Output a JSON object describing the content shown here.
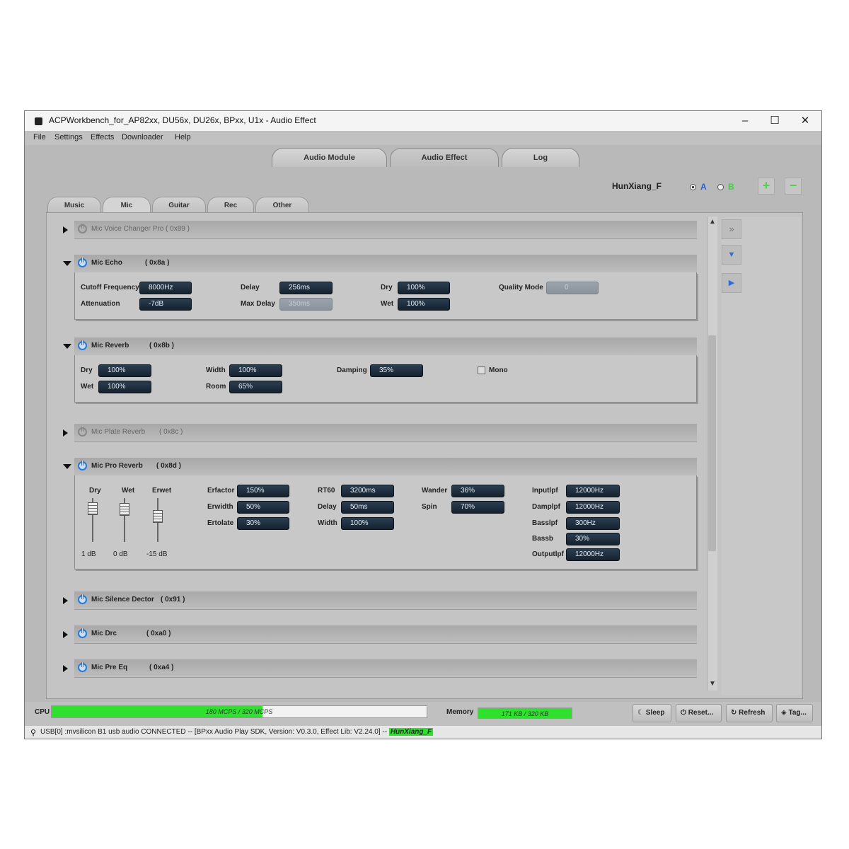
{
  "window": {
    "title": "ACPWorkbench_for_AP82xx, DU56x, DU26x, BPxx, U1x - Audio Effect",
    "minimize": "–",
    "maximize": "☐",
    "close": "✕"
  },
  "menu": [
    "File",
    "Settings",
    "Effects",
    "Downloader",
    "Help"
  ],
  "top_tabs": [
    {
      "label": "Audio Module",
      "active": false
    },
    {
      "label": "Audio Effect",
      "active": true
    },
    {
      "label": "Log",
      "active": false
    }
  ],
  "preset": {
    "name": "HunXiang_F",
    "option_a": "A",
    "option_b": "B",
    "selected": "A",
    "add_label": "+",
    "remove_label": "−",
    "accent_a": "#1f5fe0",
    "accent_b": "#3ed33e"
  },
  "sub_tabs": [
    {
      "label": "Music",
      "active": false
    },
    {
      "label": "Mic",
      "active": true
    },
    {
      "label": "Guitar",
      "active": false
    },
    {
      "label": "Rec",
      "active": false
    },
    {
      "label": "Other",
      "active": false
    }
  ],
  "sections": {
    "voice_changer": {
      "name": "Mic Voice Changer Pro ( 0x89 )",
      "enabled": false,
      "expanded": false
    },
    "echo": {
      "name": "Mic Echo",
      "code": "( 0x8a )",
      "enabled": true,
      "expanded": true,
      "cutoff_label": "Cutoff Frequency",
      "cutoff": "8000Hz",
      "attenuation_label": "Attenuation",
      "attenuation": "-7dB",
      "delay_label": "Delay",
      "delay": "256ms",
      "max_delay_label": "Max Delay",
      "max_delay": "350ms",
      "dry_label": "Dry",
      "dry": "100%",
      "wet_label": "Wet",
      "wet": "100%",
      "quality_label": "Quality Mode",
      "quality": "0"
    },
    "reverb": {
      "name": "Mic Reverb",
      "code": "( 0x8b )",
      "enabled": true,
      "expanded": true,
      "dry_label": "Dry",
      "dry": "100%",
      "wet_label": "Wet",
      "wet": "100%",
      "width_label": "Width",
      "width": "100%",
      "room_label": "Room",
      "room": "65%",
      "damping_label": "Damping",
      "damping": "35%",
      "mono_label": "Mono",
      "mono": false
    },
    "plate_reverb": {
      "name": "Mic Plate Reverb",
      "code": "( 0x8c )",
      "enabled": false,
      "expanded": false
    },
    "pro_reverb": {
      "name": "Mic Pro Reverb",
      "code": "( 0x8d )",
      "enabled": true,
      "expanded": true,
      "sliders": [
        {
          "label": "Dry",
          "value": "1 dB"
        },
        {
          "label": "Wet",
          "value": "0 dB"
        },
        {
          "label": "Erwet",
          "value": "-15 dB"
        }
      ],
      "erfactor_label": "Erfactor",
      "erfactor": "150%",
      "erwidth_label": "Erwidth",
      "erwidth": "50%",
      "ertolate_label": "Ertolate",
      "ertolate": "30%",
      "rt60_label": "RT60",
      "rt60": "3200ms",
      "delay_label": "Delay",
      "delay": "50ms",
      "width_label": "Width",
      "width": "100%",
      "wander_label": "Wander",
      "wander": "36%",
      "spin_label": "Spin",
      "spin": "70%",
      "inputlpf_label": "Inputlpf",
      "inputlpf": "12000Hz",
      "damplpf_label": "Damplpf",
      "damplpf": "12000Hz",
      "basslpf_label": "Basslpf",
      "basslpf": "300Hz",
      "bassb_label": "Bassb",
      "bassb": "30%",
      "outputlpf_label": "Outputlpf",
      "outputlpf": "12000Hz"
    },
    "silence": {
      "name": "Mic Silence Dector",
      "code": "( 0x91 )",
      "enabled": true,
      "expanded": false
    },
    "drc": {
      "name": "Mic Drc",
      "code": "( 0xa0 )",
      "enabled": true,
      "expanded": false
    },
    "pre_eq": {
      "name": "Mic Pre Eq",
      "code": "( 0xa4 )",
      "enabled": true,
      "expanded": false
    }
  },
  "side_buttons": [
    {
      "icon": "double-chevron-right-icon",
      "glyph": "»"
    },
    {
      "icon": "chevron-down-icon",
      "glyph": "▼"
    },
    {
      "icon": "play-icon",
      "glyph": "▶"
    }
  ],
  "scrollbar": {
    "up": "▲",
    "down": "▼"
  },
  "bottom": {
    "cpu_label": "CPU",
    "cpu_text": "180 MCPS / 320 MCPS",
    "cpu_fraction": 0.5625,
    "memory_label": "Memory",
    "memory_text": "171 KB / 320 KB",
    "memory_fraction": 1.0,
    "buttons": [
      {
        "icon": "moon-icon",
        "glyph": "☾",
        "label": "Sleep"
      },
      {
        "icon": "power-icon",
        "glyph": "⏻",
        "label": "Reset..."
      },
      {
        "icon": "refresh-icon",
        "glyph": "↻",
        "label": "Refresh"
      },
      {
        "icon": "tag-icon",
        "glyph": "◈",
        "label": "Tag..."
      }
    ]
  },
  "status": {
    "text": "USB[0] :mvsilicon B1 usb audio CONNECTED -- [BPxx Audio Play SDK,  Version: V0.3.0,  Effect Lib: V2.24.0] --",
    "preset": "HunXiang_F",
    "highlight": "#2fe02f"
  }
}
